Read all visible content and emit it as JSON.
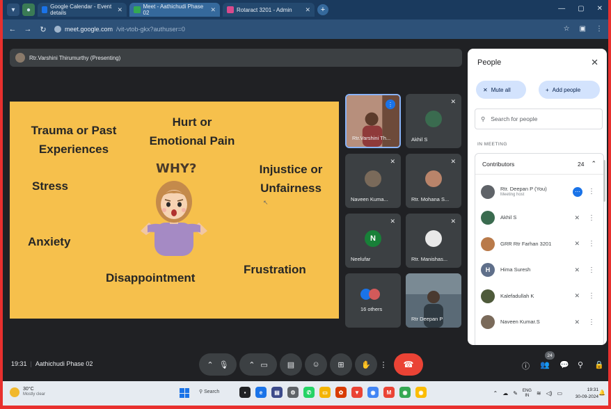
{
  "browser": {
    "tabs": [
      {
        "label": "Google Calendar - Event details",
        "active": false,
        "favicon_color": "#1a73e8"
      },
      {
        "label": "Meet - Aathichudi Phase 02",
        "active": true,
        "favicon_color": "#34a853"
      },
      {
        "label": "Rotaract 3201 - Admin",
        "active": false,
        "favicon_color": "#d94a8c"
      }
    ],
    "url_host": "meet.google.com",
    "url_path": "/vit-vtob-gkx?authuser=0"
  },
  "presenter": {
    "label": "Rtr.Varshini Thirumurthy (Presenting)"
  },
  "slide": {
    "question": "WHY?",
    "words": {
      "trauma": "Trauma or Past Experiences",
      "hurt": "Hurt or Emotional Pain",
      "injustice": "Injustice or Unfairness",
      "stress": "Stress",
      "anxiety": "Anxiety",
      "disappointment": "Disappointment",
      "frustration": "Frustration"
    }
  },
  "tiles": [
    {
      "name": "Rtr.Varshini Th...",
      "type": "video",
      "speaking": true
    },
    {
      "name": "Akhil S",
      "type": "avatar",
      "muted": true
    },
    {
      "name": "Naveen Kuma...",
      "type": "avatar",
      "muted": true
    },
    {
      "name": "Rtr. Mohana S...",
      "type": "avatar",
      "muted": true
    },
    {
      "name": "Neelufar",
      "type": "letter",
      "letter": "N",
      "muted": true
    },
    {
      "name": "Rtr. Manishas...",
      "type": "avatar",
      "muted": true
    },
    {
      "name": "16 others",
      "type": "group"
    },
    {
      "name": "Rtr Deepan P",
      "type": "video"
    }
  ],
  "people_panel": {
    "title": "People",
    "mute_all": "Mute all",
    "add_people": "Add people",
    "search_placeholder": "Search for people",
    "section": "IN MEETING",
    "group": "Contributors",
    "count": "24",
    "participants": [
      {
        "name": "Rtr. Deepan P (You)",
        "sub": "Meeting host",
        "color": "#5f6368"
      },
      {
        "name": "Akhil S",
        "sub": "",
        "color": "#3a6b4f"
      },
      {
        "name": "GRR Rtr Farhan 3201",
        "sub": "",
        "color": "#b97a4a"
      },
      {
        "name": "Hima Suresh",
        "sub": "",
        "color": "#5f6f8a",
        "letter": "H"
      },
      {
        "name": "Kalefadullah K",
        "sub": "",
        "color": "#4e5a3a"
      },
      {
        "name": "Naveen Kumar.S",
        "sub": "",
        "color": "#7a6a5a"
      }
    ]
  },
  "meeting_bar": {
    "time": "19:31",
    "name": "Aathichudi Phase 02",
    "participants_badge": "24"
  },
  "taskbar": {
    "temp": "30°C",
    "weather": "Mostly clear",
    "search": "Search",
    "lang_top": "ENG",
    "lang_bottom": "IN",
    "clock_time": "19:31",
    "clock_date": "30-09-2024"
  },
  "colors": {
    "slide_bg": "#f6c04c",
    "meet_bg": "#202124",
    "end_call": "#ea4335",
    "accent_blue": "#1a73e8"
  }
}
